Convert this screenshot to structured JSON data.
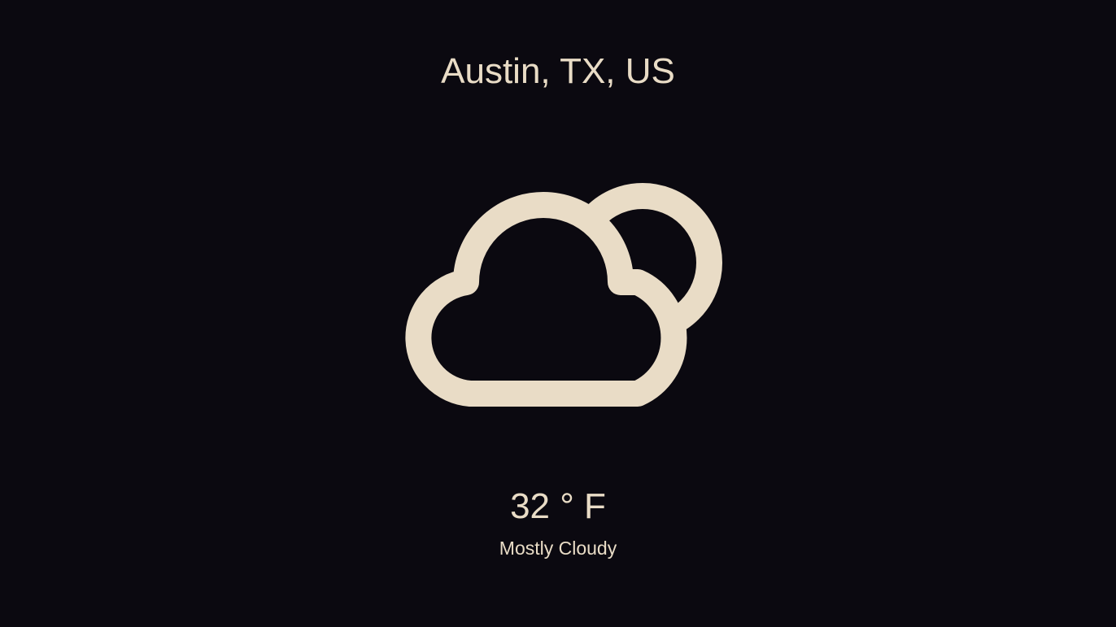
{
  "weather": {
    "location": "Austin, TX, US",
    "icon": "partly-cloudy-night-icon",
    "temperature": "32 ° F",
    "condition": "Mostly Cloudy"
  },
  "colors": {
    "background": "#0b0910",
    "foreground": "#e9dcc6"
  }
}
